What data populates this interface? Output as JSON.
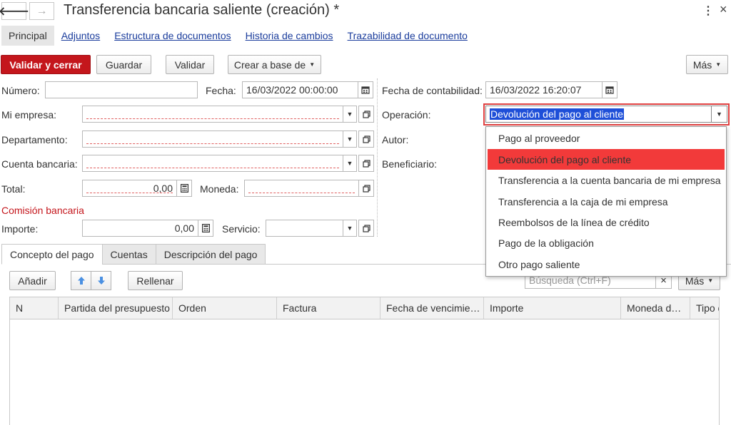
{
  "window": {
    "title": "Transferencia bancaria saliente (creación) *",
    "back_glyph": "🡐",
    "forward_glyph": "→",
    "menu_glyph": "⋮",
    "close_glyph": "×"
  },
  "nav_tabs": [
    "Principal",
    "Adjuntos",
    "Estructura de documentos",
    "Historia de cambios",
    "Trazabilidad de documento"
  ],
  "toolbar": {
    "validate_close": "Validar y cerrar",
    "save": "Guardar",
    "validate": "Validar",
    "create_based": "Crear a base de",
    "more": "Más"
  },
  "form": {
    "numero_label": "Número:",
    "numero_value": "",
    "fecha_label": "Fecha:",
    "fecha_value": "16/03/2022 00:00:00",
    "fecha_contab_label": "Fecha de contabilidad:",
    "fecha_contab_value": "16/03/2022 16:20:07",
    "mi_empresa_label": "Mi empresa:",
    "operacion_label": "Operación:",
    "operacion_value": "Devolución del pago al cliente",
    "departamento_label": "Departamento:",
    "autor_label": "Autor:",
    "cuenta_label": "Cuenta bancaria:",
    "beneficiario_label": "Beneficiario:",
    "total_label": "Total:",
    "total_value": "0,00",
    "moneda_label": "Moneda:",
    "comision_label": "Comisión bancaria",
    "importe_label": "Importe:",
    "importe_value": "0,00",
    "servicio_label": "Servicio:"
  },
  "lower_tabs": [
    "Concepto del pago",
    "Cuentas",
    "Descripción del pago"
  ],
  "table_toolbar": {
    "add": "Añadir",
    "fill": "Rellenar",
    "search_placeholder": "Búsqueda (Ctrl+F)",
    "clear_glyph": "×",
    "more": "Más"
  },
  "table": {
    "columns": [
      "N",
      "Partida del presupuesto",
      "Orden",
      "Factura",
      "Fecha de vencimie…",
      "Importe",
      "Moneda d…",
      "Tipo d"
    ]
  },
  "dropdown": {
    "options": [
      "Pago al proveedor",
      "Devolución del pago al cliente",
      "Transferencia a la cuenta bancaria de mi empresa",
      "Transferencia a la caja de mi empresa",
      "Reembolsos de la línea de crédito",
      "Pago de la obligación",
      "Otro pago saliente"
    ],
    "selected_index": 1
  },
  "colors": {
    "primary": "#c4161c",
    "selected_option": "#f23a3a",
    "link": "#1a3c9c",
    "highlight_text_bg": "#1e4fd8"
  }
}
